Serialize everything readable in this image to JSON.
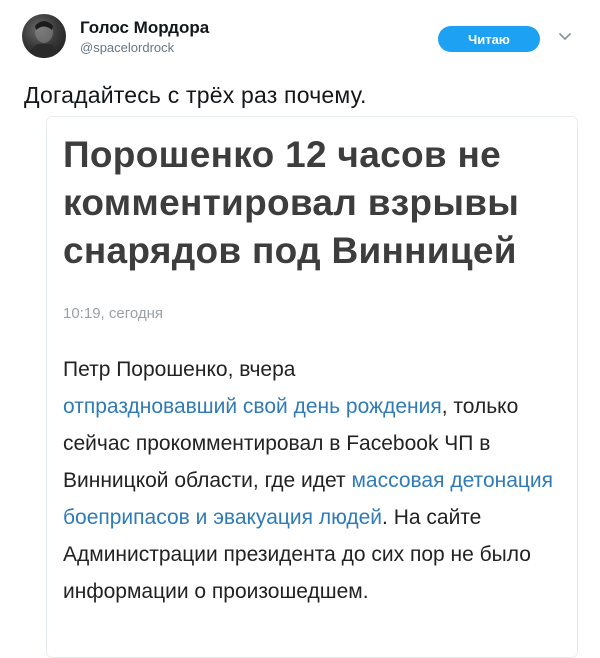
{
  "tweet": {
    "display_name": "Голос Мордора",
    "handle": "@spacelordrock",
    "follow_label": "Читаю",
    "text": "Догадайтесь с трёх раз почему.",
    "avatar_icon": "avatar-portrait",
    "menu_icon": "chevron-down-icon"
  },
  "article": {
    "headline": "Порошенко 12 часов не комментировал взрывы снарядов под Винницей",
    "timestamp": "10:19, сегодня",
    "p1": "Петр Порошенко, вчера",
    "link1": "отпраздновавший свой день рождения",
    "p2": ", только сейчас прокомментировал в Facebook ЧП в Винницкой области, где идет",
    "link2": "массовая детонация боеприпасов и эвакуация людей",
    "p3": ". На сайте Администрации президента до сих пор не было информации о произошедшем."
  },
  "colors": {
    "accent": "#1da1f2",
    "link": "#2f7bb8",
    "headline": "#3d3d3d",
    "muted": "#657786"
  }
}
